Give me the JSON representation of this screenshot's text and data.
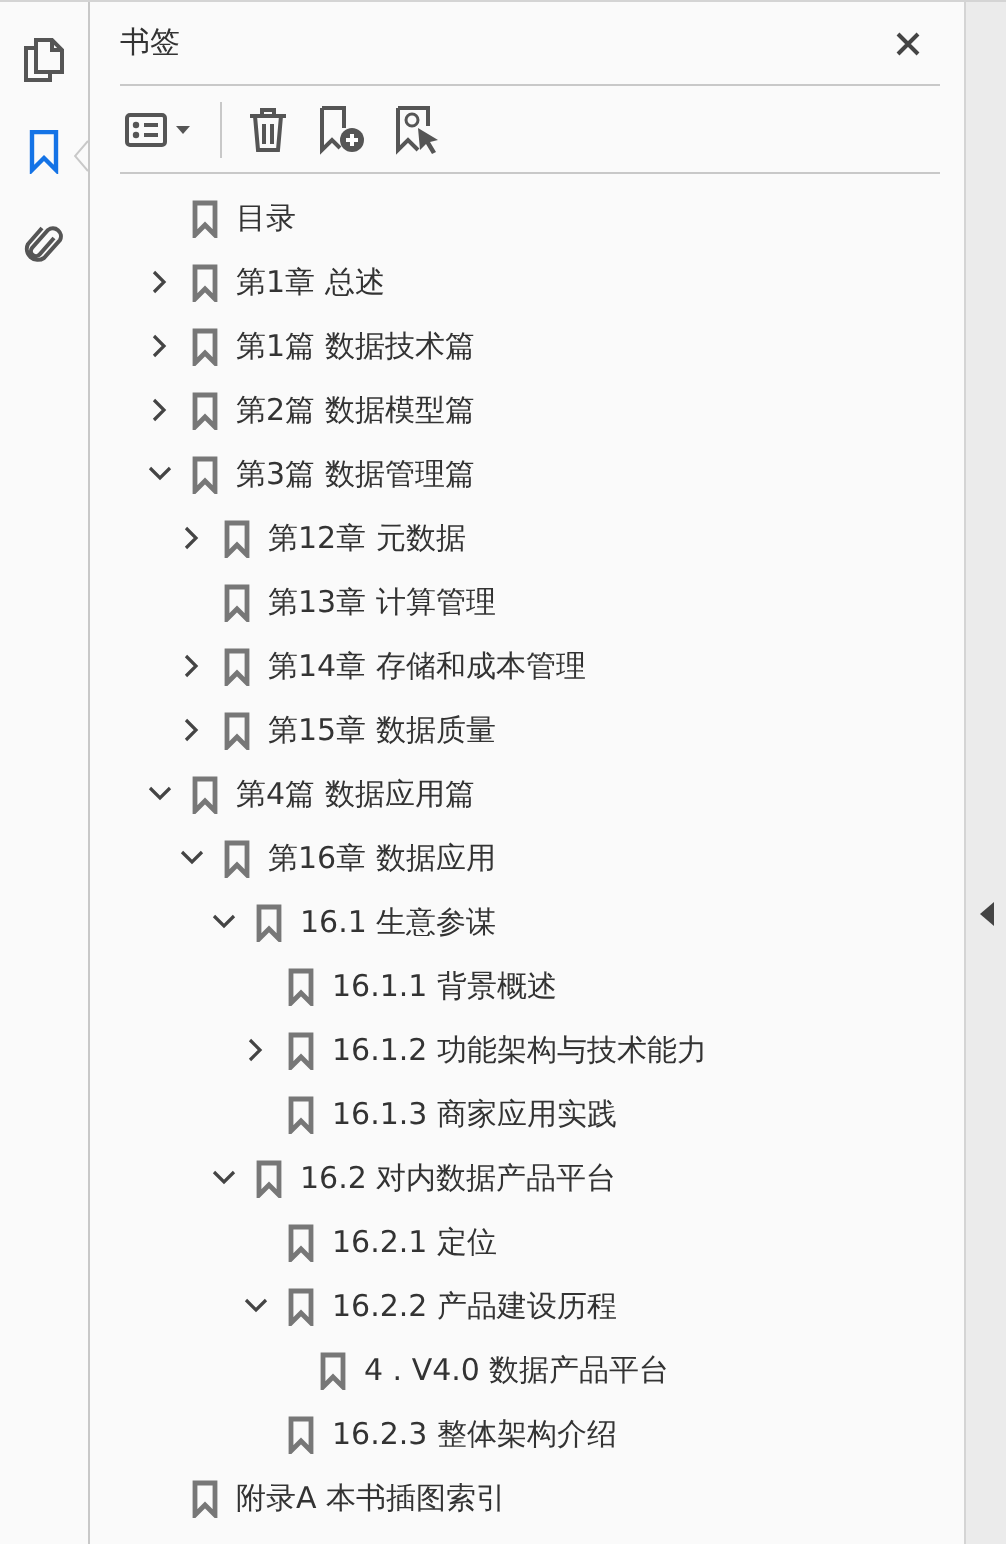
{
  "rail": {
    "items": [
      {
        "kind": "pages",
        "selected": false
      },
      {
        "kind": "bookmarks",
        "selected": true
      },
      {
        "kind": "attachments",
        "selected": false
      }
    ]
  },
  "panel": {
    "title": "书签"
  },
  "bookmarks": [
    {
      "label": "目录",
      "kind": "leaf"
    },
    {
      "label": "第1章 总述",
      "kind": "folder",
      "expanded": false
    },
    {
      "label": "第1篇 数据技术篇",
      "kind": "folder",
      "expanded": false
    },
    {
      "label": "第2篇 数据模型篇",
      "kind": "folder",
      "expanded": false
    },
    {
      "label": "第3篇 数据管理篇",
      "kind": "folder",
      "expanded": true,
      "children": [
        {
          "label": "第12章 元数据",
          "kind": "folder",
          "expanded": false
        },
        {
          "label": "第13章 计算管理",
          "kind": "leaf"
        },
        {
          "label": "第14章 存储和成本管理",
          "kind": "folder",
          "expanded": false
        },
        {
          "label": "第15章 数据质量",
          "kind": "folder",
          "expanded": false
        }
      ]
    },
    {
      "label": "第4篇 数据应用篇",
      "kind": "folder",
      "expanded": true,
      "children": [
        {
          "label": "第16章 数据应用",
          "kind": "folder",
          "expanded": true,
          "children": [
            {
              "label": "16.1 生意参谋",
              "kind": "folder",
              "expanded": true,
              "children": [
                {
                  "label": "16.1.1 背景概述",
                  "kind": "leaf"
                },
                {
                  "label": "16.1.2 功能架构与技术能力",
                  "kind": "folder",
                  "expanded": false
                },
                {
                  "label": "16.1.3 商家应用实践",
                  "kind": "leaf"
                }
              ]
            },
            {
              "label": "16.2 对内数据产品平台",
              "kind": "folder",
              "expanded": true,
              "children": [
                {
                  "label": "16.2.1 定位",
                  "kind": "leaf"
                },
                {
                  "label": "16.2.2 产品建设历程",
                  "kind": "folder",
                  "expanded": true,
                  "children": [
                    {
                      "label": "4 . V4.0 数据产品平台",
                      "kind": "leaf"
                    }
                  ]
                },
                {
                  "label": "16.2.3 整体架构介绍",
                  "kind": "leaf"
                }
              ]
            }
          ]
        }
      ]
    },
    {
      "label": "附录A 本书插图索引",
      "kind": "leaf"
    }
  ]
}
